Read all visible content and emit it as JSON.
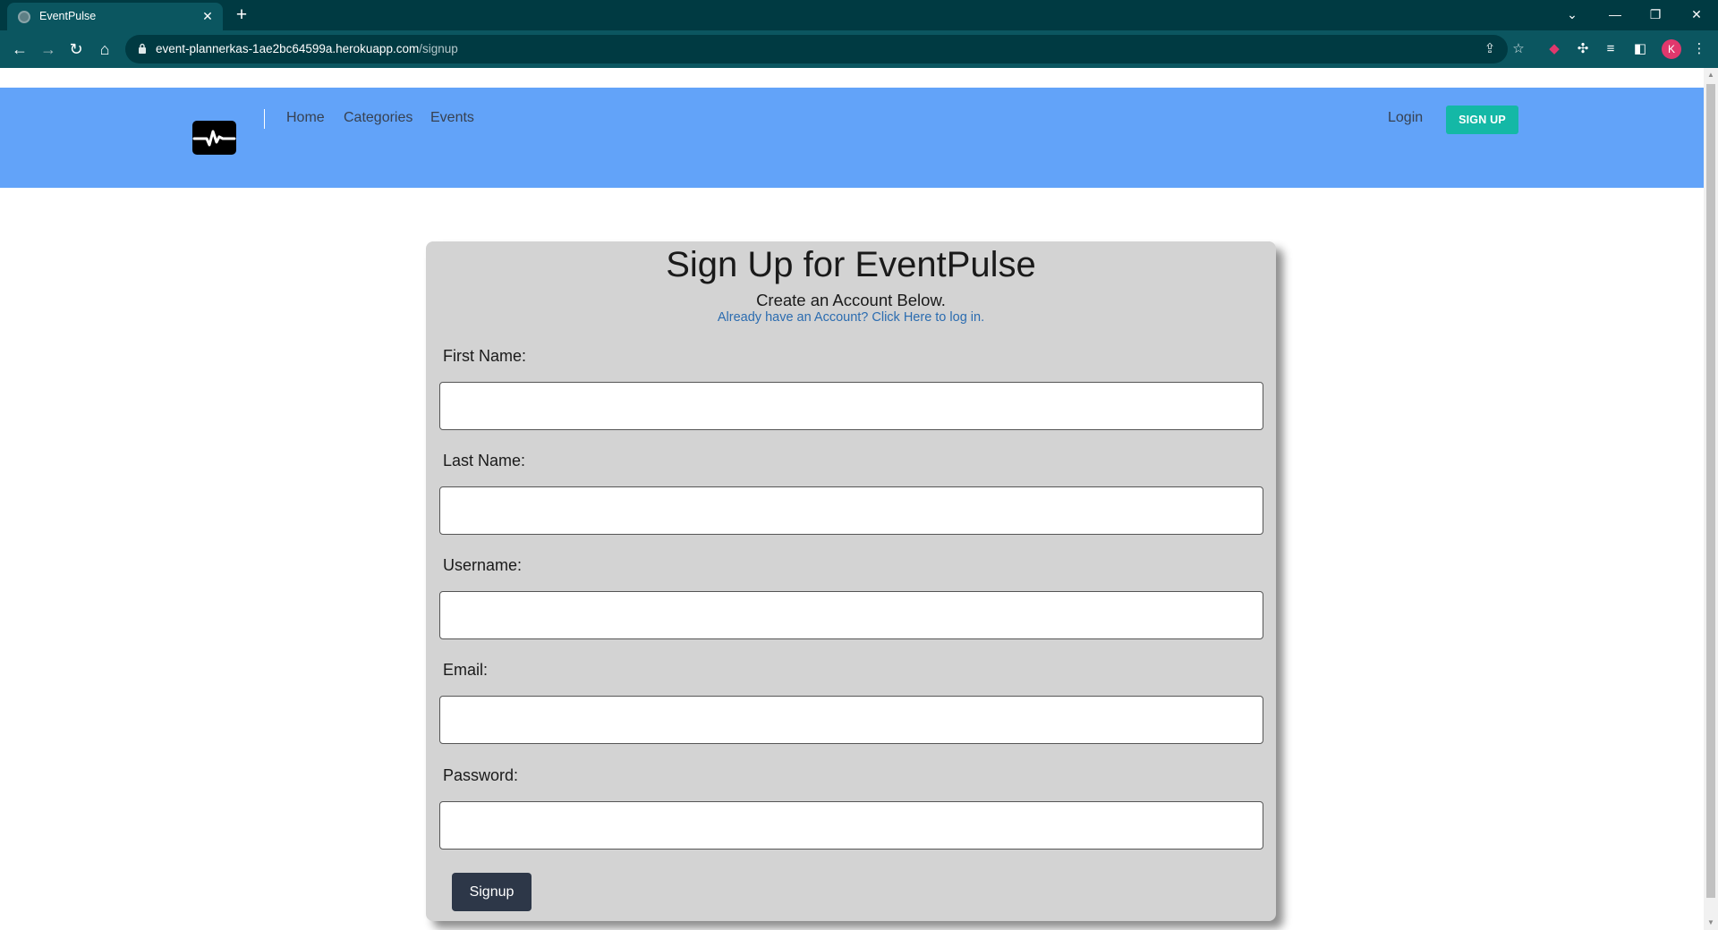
{
  "browser": {
    "tab_title": "EventPulse",
    "url_host": "event-plannerkas-1ae2bc64599a.herokuapp.com",
    "url_path": "/signup",
    "profile_initial": "K"
  },
  "header": {
    "nav": [
      "Home",
      "Categories",
      "Events"
    ],
    "login_label": "Login",
    "signup_label": "SIGN UP"
  },
  "form": {
    "title": "Sign Up for EventPulse",
    "subtitle": "Create an Account Below.",
    "login_prompt": "Already have an Account? Click Here to log in.",
    "fields": [
      {
        "label": "First Name:",
        "value": ""
      },
      {
        "label": "Last Name:",
        "value": ""
      },
      {
        "label": "Username:",
        "value": ""
      },
      {
        "label": "Email:",
        "value": ""
      },
      {
        "label": "Password:",
        "value": ""
      }
    ],
    "submit_label": "Signup"
  },
  "colors": {
    "header_bg": "#62a3f9",
    "signup_accent": "#14b8a6",
    "card_bg": "#d3d3d3",
    "submit_bg": "#2d3748",
    "chrome_dark": "#003a42",
    "chrome_toolbar": "#0b5660"
  }
}
